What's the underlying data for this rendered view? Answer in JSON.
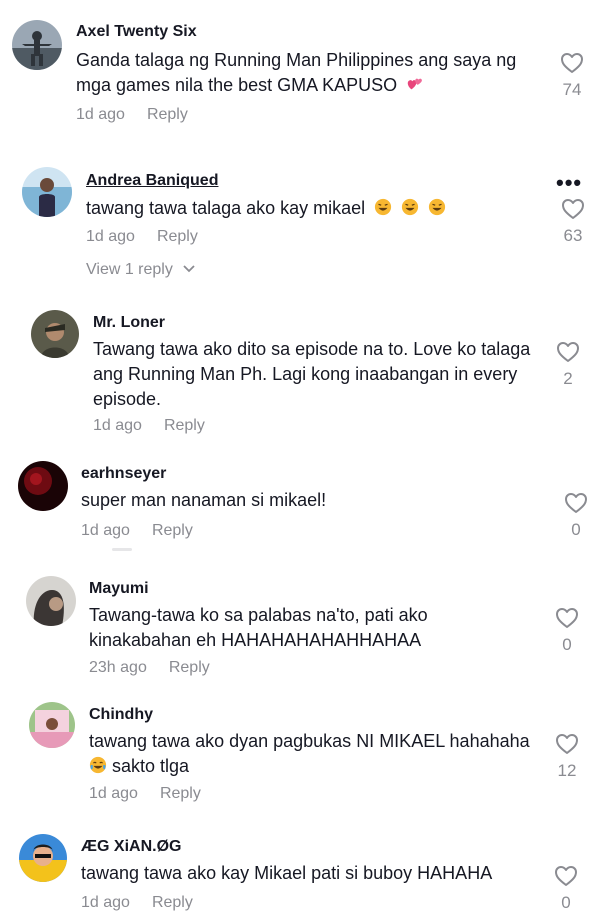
{
  "comments": [
    {
      "username": "Axel Twenty Six",
      "text": "Ganda talaga ng Running Man Philippines ang saya ng mga games nila the best GMA KAPUSO",
      "time": "1d ago",
      "reply": "Reply",
      "likes": "74"
    },
    {
      "username": "Andrea Baniqued",
      "text": "tawang tawa talaga ako kay mikael",
      "time": "1d ago",
      "reply": "Reply",
      "likes": "63",
      "view_replies": "View 1 reply"
    },
    {
      "username": "Mr. Loner",
      "text": "Tawang tawa ako dito sa episode na to. Love ko talaga ang Running Man Ph. Lagi kong inaabangan in every episode.",
      "time": "1d ago",
      "reply": "Reply",
      "likes": "2"
    },
    {
      "username": "earhnseyer",
      "text": "super man nanaman si mikael!",
      "time": "1d ago",
      "reply": "Reply",
      "likes": "0"
    },
    {
      "username": "Mayumi",
      "text": "Tawang-tawa ko sa palabas na'to, pati ako kinakabahan eh HAHAHAHAHAHHAHAA",
      "time": "23h ago",
      "reply": "Reply",
      "likes": "0"
    },
    {
      "username": "Chindhy",
      "text_part1": "tawang tawa ako dyan pagbukas NI MIKAEL hahahaha",
      "text_part2": " sakto tlga",
      "time": "1d ago",
      "reply": "Reply",
      "likes": "12"
    },
    {
      "username": "ÆG XiAN.ØG",
      "text": "tawang tawa ako kay Mikael pati si buboy HAHAHA",
      "time": "1d ago",
      "reply": "Reply",
      "likes": "0"
    }
  ],
  "more_label": "•••",
  "colors": {
    "text": "#161823",
    "secondary": "#8a8b91",
    "heart_emoji": "#e8467c"
  }
}
